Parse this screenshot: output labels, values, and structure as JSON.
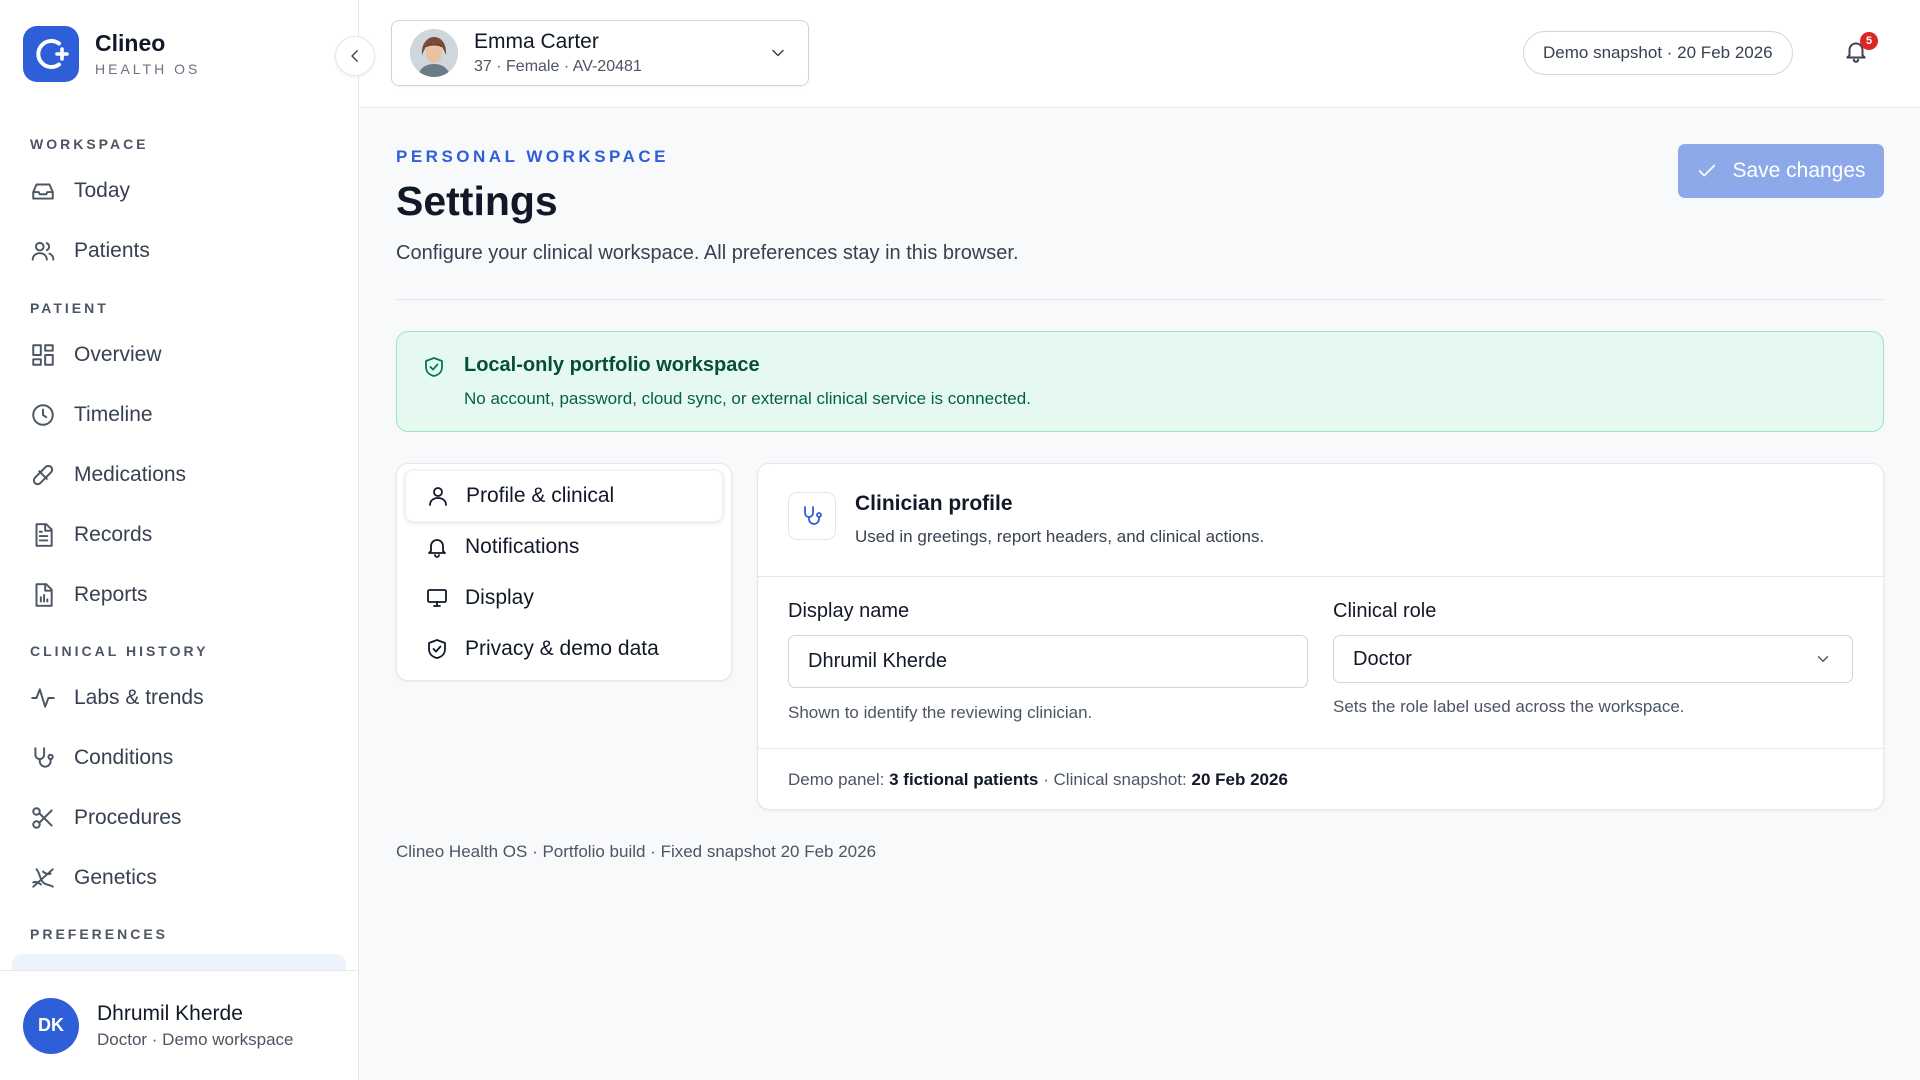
{
  "brand": {
    "name": "Clineo",
    "subtitle": "HEALTH OS"
  },
  "sidebar": {
    "sections": {
      "workspace": "WORKSPACE",
      "patient": "PATIENT",
      "clinical_history": "CLINICAL HISTORY",
      "preferences": "PREFERENCES"
    },
    "items": [
      {
        "label": "Today",
        "icon": "inbox-icon"
      },
      {
        "label": "Patients",
        "icon": "users-icon"
      },
      {
        "label": "Overview",
        "icon": "grid-icon"
      },
      {
        "label": "Timeline",
        "icon": "clock-icon"
      },
      {
        "label": "Medications",
        "icon": "pill-icon"
      },
      {
        "label": "Records",
        "icon": "document-icon"
      },
      {
        "label": "Reports",
        "icon": "report-icon"
      },
      {
        "label": "Labs & trends",
        "icon": "activity-icon"
      },
      {
        "label": "Conditions",
        "icon": "stethoscope-icon"
      },
      {
        "label": "Procedures",
        "icon": "scissors-icon"
      },
      {
        "label": "Genetics",
        "icon": "dna-icon"
      }
    ],
    "user": {
      "initials": "DK",
      "name": "Dhrumil Kherde",
      "role": "Doctor · Demo workspace"
    }
  },
  "topbar": {
    "patient": {
      "name": "Emma Carter",
      "meta": "37 · Female · AV-20481"
    },
    "snapshot": "Demo snapshot · 20 Feb 2026",
    "notifications_count": "5"
  },
  "page": {
    "eyebrow": "PERSONAL WORKSPACE",
    "title": "Settings",
    "description": "Configure your clinical workspace. All preferences stay in this browser.",
    "save_label": "Save changes"
  },
  "notice": {
    "title": "Local-only portfolio workspace",
    "text": "No account, password, cloud sync, or external clinical service is connected."
  },
  "settings_tabs": [
    {
      "label": "Profile & clinical",
      "icon": "user-icon"
    },
    {
      "label": "Notifications",
      "icon": "bell-icon"
    },
    {
      "label": "Display",
      "icon": "monitor-icon"
    },
    {
      "label": "Privacy & demo data",
      "icon": "shield-icon"
    }
  ],
  "profile": {
    "title": "Clinician profile",
    "subtitle": "Used in greetings, report headers, and clinical actions.",
    "display_name": {
      "label": "Display name",
      "value": "Dhrumil Kherde",
      "hint": "Shown to identify the reviewing clinician."
    },
    "clinical_role": {
      "label": "Clinical role",
      "value": "Doctor",
      "hint": "Sets the role label used across the workspace."
    },
    "demo": {
      "panel_label": "Demo panel:",
      "panel_value": "3 fictional patients",
      "separator": "·",
      "snapshot_label": "Clinical snapshot:",
      "snapshot_value": "20 Feb 2026"
    }
  },
  "footer": "Clineo Health OS · Portfolio build · Fixed snapshot 20 Feb 2026",
  "colors": {
    "accent": "#2f5fd8",
    "notice_bg": "#e6f9f1",
    "badge": "#dc2626"
  }
}
